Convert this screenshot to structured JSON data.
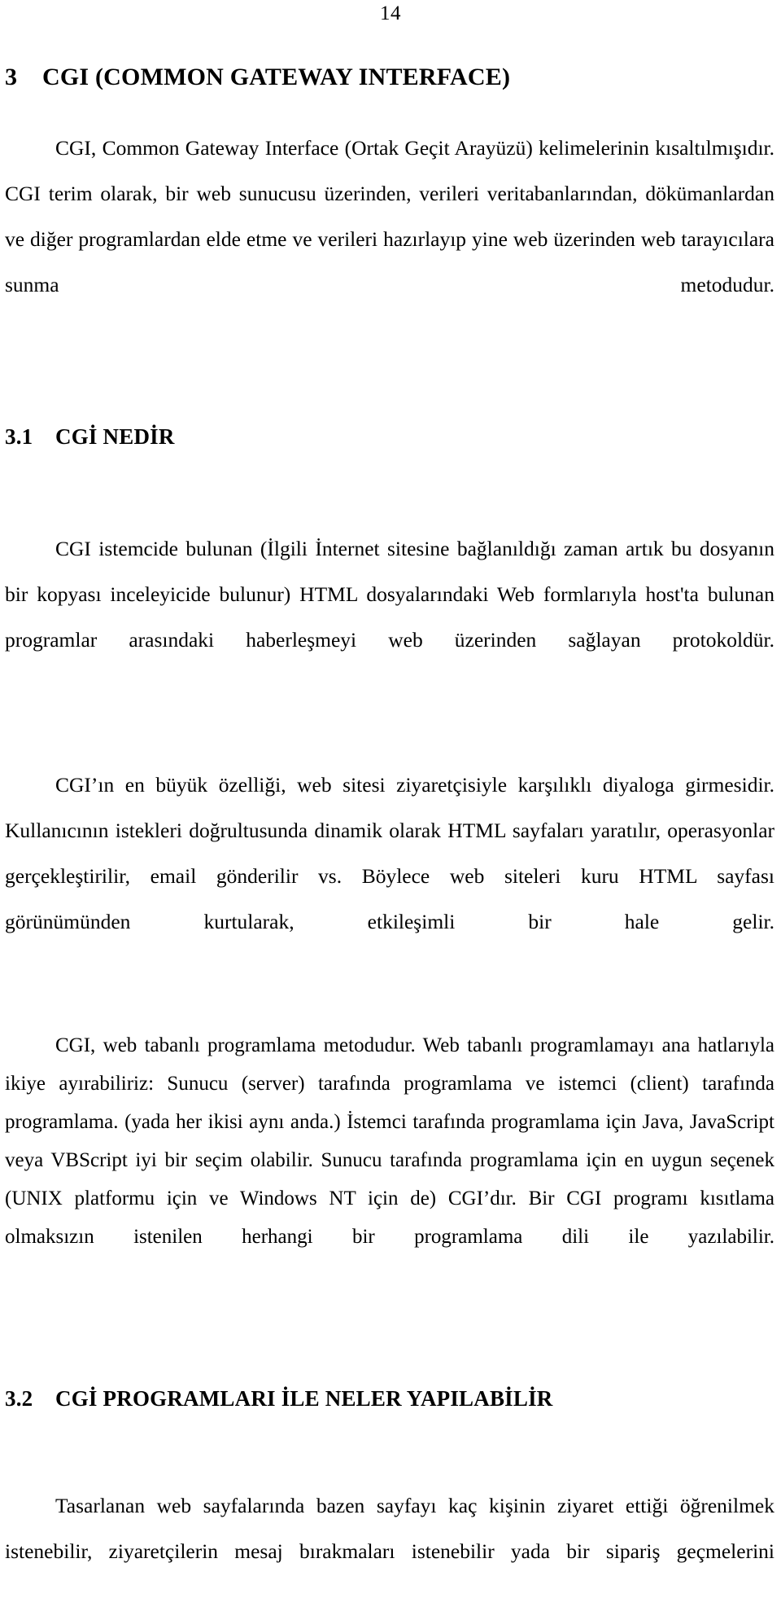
{
  "page": {
    "number": "14"
  },
  "headings": {
    "h1": {
      "number": "3",
      "title": "CGI (COMMON GATEWAY INTERFACE)"
    },
    "h2_1": {
      "number": "3.1",
      "title": "CGİ NEDİR"
    },
    "h2_2": {
      "number": "3.2",
      "title": "CGİ PROGRAMLARI İLE NELER YAPILABİLİR"
    }
  },
  "paragraphs": {
    "p1": "CGI, Common Gateway Interface (Ortak Geçit Arayüzü) kelimelerinin kısaltılmışıdır. CGI terim olarak, bir web sunucusu üzerinden, verileri veritabanlarından, dökümanlardan ve diğer programlardan elde etme ve verileri hazırlayıp yine web üzerinden web tarayıcılara sunma metodudur.",
    "p2": "CGI istemcide bulunan (İlgili İnternet sitesine bağlanıldığı zaman artık bu dosyanın bir kopyası inceleyicide bulunur) HTML dosyalarındaki Web formlarıyla host'ta bulunan programlar arasındaki haberleşmeyi web üzerinden sağlayan protokoldür.",
    "p3": "CGI’ın en büyük özelliği, web sitesi ziyaretçisiyle karşılıklı diyaloga girmesidir. Kullanıcının istekleri doğrultusunda dinamik olarak HTML sayfaları yaratılır, operasyonlar gerçekleştirilir, email gönderilir vs. Böylece web siteleri kuru HTML sayfası görünümünden kurtularak, etkileşimli bir hale gelir.",
    "p4": "CGI, web tabanlı programlama metodudur. Web tabanlı programlamayı ana hatlarıyla ikiye ayırabiliriz: Sunucu (server) tarafında programlama ve istemci (client) tarafında programlama. (yada her ikisi aynı anda.) İstemci tarafında programlama için Java, JavaScript veya VBScript iyi bir seçim olabilir. Sunucu tarafında programlama için en uygun seçenek (UNIX platformu için ve Windows NT için de) CGI’dır. Bir CGI programı kısıtlama olmaksızın istenilen herhangi bir programlama dili ile yazılabilir.",
    "p5": "Tasarlanan web sayfalarında bazen sayfayı kaç kişinin ziyaret ettiği öğrenilmek istenebilir, ziyaretçilerin mesaj bırakmaları istenebilir yada bir sipariş geçmelerini"
  }
}
